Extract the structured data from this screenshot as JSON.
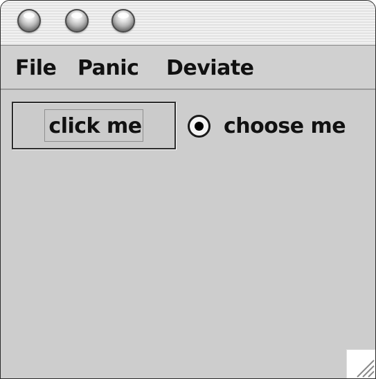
{
  "window": {
    "titlebar_buttons": [
      "close-button",
      "minimize-button",
      "zoom-button"
    ]
  },
  "menubar": {
    "items": [
      {
        "label": "File"
      },
      {
        "label": "Panic"
      },
      {
        "label": "Deviate"
      }
    ]
  },
  "content": {
    "button_label": "click me",
    "radio_label": "choose me",
    "radio_selected": true
  },
  "icons": {
    "resize_grip": "resize-grip-icon"
  }
}
